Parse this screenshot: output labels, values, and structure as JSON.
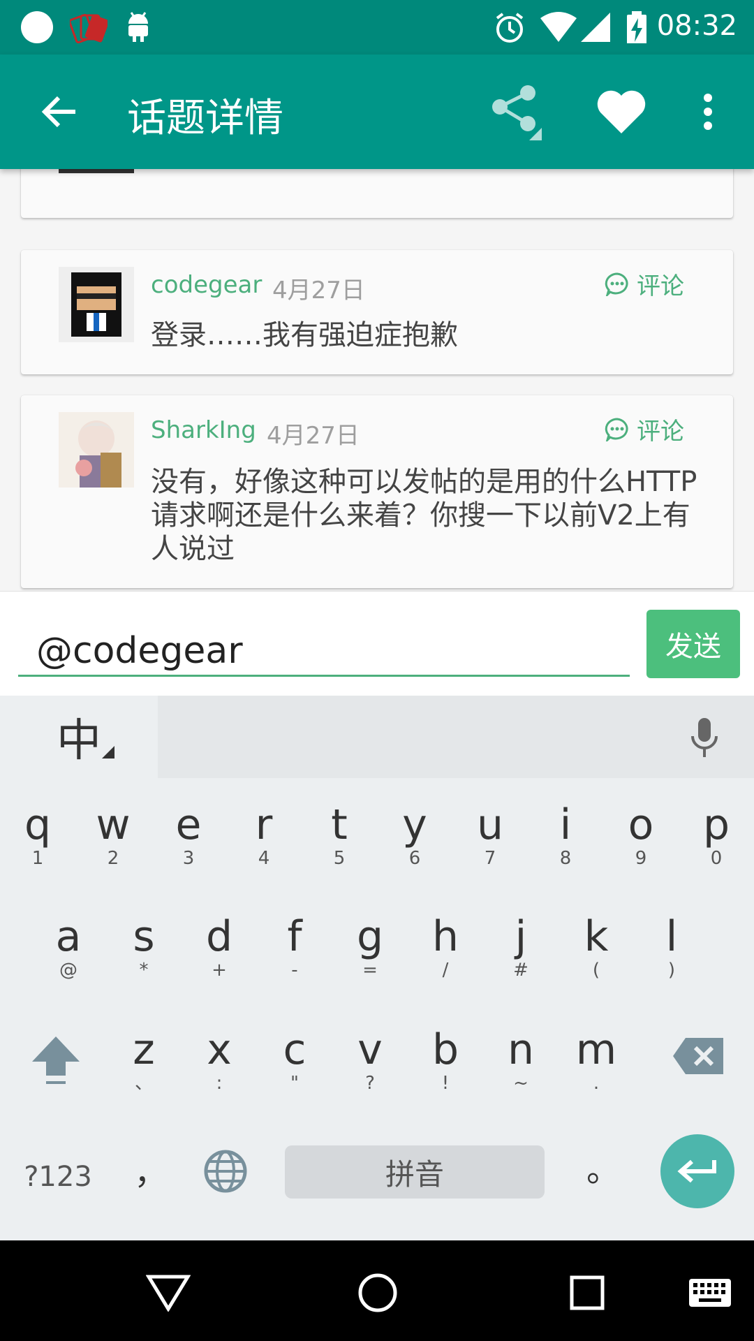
{
  "status_bar": {
    "time": "08:32",
    "icons": [
      "circle-icon",
      "cards-icon",
      "android-icon",
      "alarm-icon",
      "wifi-icon",
      "signal-icon",
      "battery-charging-icon"
    ]
  },
  "toolbar": {
    "title": "话题详情",
    "icons": [
      "back-arrow-icon",
      "share-icon",
      "heart-icon",
      "more-vert-icon"
    ]
  },
  "comments": [
    {
      "username": "codegear",
      "date": "4月27日",
      "comment_label": "评论",
      "text": "登录……我有强迫症抱歉"
    },
    {
      "username": "SharkIng",
      "date": "4月27日",
      "comment_label": "评论",
      "text": "没有，好像这种可以发帖的是用的什么HTTP请求啊还是什么来着？你搜一下以前V2上有人说过"
    }
  ],
  "reply": {
    "value": "@codegear",
    "send_label": "发送"
  },
  "keyboard": {
    "lang_label": "中",
    "row1": [
      [
        "q",
        "1"
      ],
      [
        "w",
        "2"
      ],
      [
        "e",
        "3"
      ],
      [
        "r",
        "4"
      ],
      [
        "t",
        "5"
      ],
      [
        "y",
        "6"
      ],
      [
        "u",
        "7"
      ],
      [
        "i",
        "8"
      ],
      [
        "o",
        "9"
      ],
      [
        "p",
        "0"
      ]
    ],
    "row2": [
      [
        "a",
        "@"
      ],
      [
        "s",
        "*"
      ],
      [
        "d",
        "+"
      ],
      [
        "f",
        "-"
      ],
      [
        "g",
        "="
      ],
      [
        "h",
        "/"
      ],
      [
        "j",
        "#"
      ],
      [
        "k",
        "("
      ],
      [
        "l",
        ")"
      ]
    ],
    "row3": [
      [
        "z",
        "、"
      ],
      [
        "x",
        ":"
      ],
      [
        "c",
        "\""
      ],
      [
        "v",
        "?"
      ],
      [
        "b",
        "!"
      ],
      [
        "n",
        "~"
      ],
      [
        "m",
        "."
      ]
    ],
    "symbols_label": "?123",
    "comma_label": "，",
    "space_label": "拼音",
    "period_label": "。"
  },
  "nav_bar": {
    "icons": [
      "back-triangle-icon",
      "home-circle-icon",
      "recents-square-icon",
      "keyboard-icon"
    ]
  }
}
